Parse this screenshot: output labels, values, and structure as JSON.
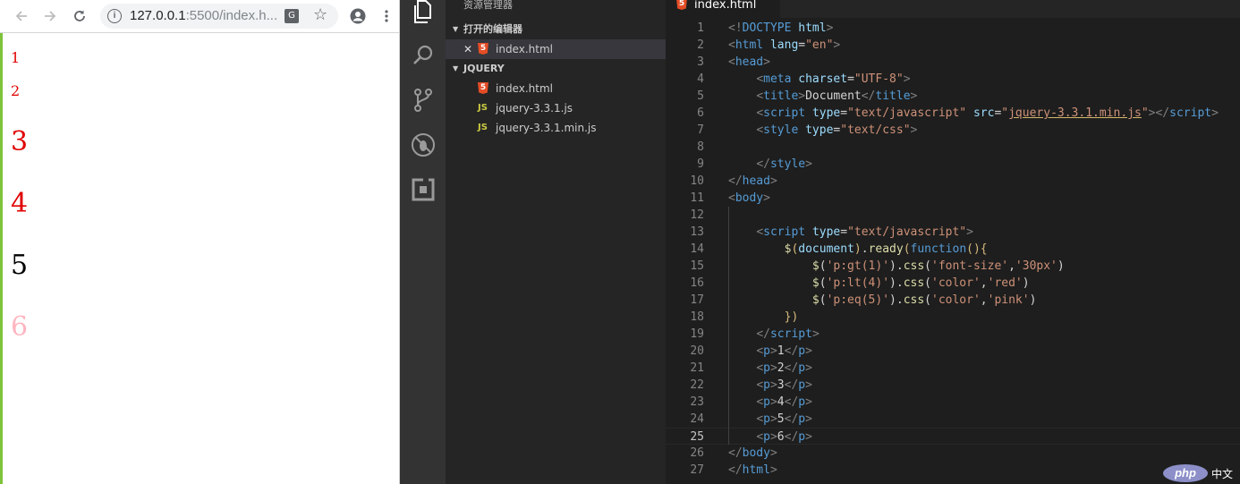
{
  "browser": {
    "url_host": "127.0.0.1",
    "url_rest": ":5500/index.h...",
    "paragraphs": [
      {
        "text": "1",
        "color": "#e00000"
      },
      {
        "text": "2",
        "color": "#e00000"
      },
      {
        "text": "3",
        "color": "#e00000"
      },
      {
        "text": "4",
        "color": "#e00000"
      },
      {
        "text": "5",
        "color": "#000000"
      },
      {
        "text": "6",
        "color": "#ffb6c1"
      }
    ]
  },
  "sidebar": {
    "title": "资源管理器",
    "open_editors_label": "打开的编辑器",
    "open_editor_file": "index.html",
    "project_label": "JQUERY",
    "files": [
      {
        "name": "index.html",
        "type": "html"
      },
      {
        "name": "jquery-3.3.1.js",
        "type": "js"
      },
      {
        "name": "jquery-3.3.1.min.js",
        "type": "js"
      }
    ],
    "html_badge": "5",
    "js_badge": "JS"
  },
  "editor": {
    "tab_label": "index.html",
    "current_line": 25,
    "lines": [
      [
        [
          "t-bracket",
          "<!"
        ],
        [
          "t-tag",
          "DOCTYPE"
        ],
        [
          "t-text",
          " "
        ],
        [
          "t-attr",
          "html"
        ],
        [
          "t-bracket",
          ">"
        ]
      ],
      [
        [
          "t-bracket",
          "<"
        ],
        [
          "t-tag",
          "html"
        ],
        [
          "t-text",
          " "
        ],
        [
          "t-attr",
          "lang"
        ],
        [
          "t-text",
          "="
        ],
        [
          "t-str",
          "\"en\""
        ],
        [
          "t-bracket",
          ">"
        ]
      ],
      [
        [
          "t-bracket",
          "<"
        ],
        [
          "t-tag",
          "head"
        ],
        [
          "t-bracket",
          ">"
        ]
      ],
      [
        [
          "t-text",
          "    "
        ],
        [
          "t-bracket",
          "<"
        ],
        [
          "t-tag",
          "meta"
        ],
        [
          "t-text",
          " "
        ],
        [
          "t-attr",
          "charset"
        ],
        [
          "t-text",
          "="
        ],
        [
          "t-str",
          "\"UTF-8\""
        ],
        [
          "t-bracket",
          ">"
        ]
      ],
      [
        [
          "t-text",
          "    "
        ],
        [
          "t-bracket",
          "<"
        ],
        [
          "t-tag",
          "title"
        ],
        [
          "t-bracket",
          ">"
        ],
        [
          "t-text",
          "Document"
        ],
        [
          "t-bracket",
          "</"
        ],
        [
          "t-tag",
          "title"
        ],
        [
          "t-bracket",
          ">"
        ]
      ],
      [
        [
          "t-text",
          "    "
        ],
        [
          "t-bracket",
          "<"
        ],
        [
          "t-tag",
          "script"
        ],
        [
          "t-text",
          " "
        ],
        [
          "t-attr",
          "type"
        ],
        [
          "t-text",
          "="
        ],
        [
          "t-str",
          "\"text/javascript\""
        ],
        [
          "t-text",
          " "
        ],
        [
          "t-attr",
          "src"
        ],
        [
          "t-text",
          "="
        ],
        [
          "t-str",
          "\""
        ],
        [
          "t-str t-under",
          "jquery-3.3.1.min.js"
        ],
        [
          "t-str",
          "\""
        ],
        [
          "t-bracket",
          "></"
        ],
        [
          "t-tag",
          "script"
        ],
        [
          "t-bracket",
          ">"
        ]
      ],
      [
        [
          "t-text",
          "    "
        ],
        [
          "t-bracket",
          "<"
        ],
        [
          "t-tag",
          "style"
        ],
        [
          "t-text",
          " "
        ],
        [
          "t-attr",
          "type"
        ],
        [
          "t-text",
          "="
        ],
        [
          "t-str",
          "\"text/css\""
        ],
        [
          "t-bracket",
          ">"
        ]
      ],
      [],
      [
        [
          "t-text",
          "    "
        ],
        [
          "t-bracket",
          "</"
        ],
        [
          "t-tag",
          "style"
        ],
        [
          "t-bracket",
          ">"
        ]
      ],
      [
        [
          "t-bracket",
          "</"
        ],
        [
          "t-tag",
          "head"
        ],
        [
          "t-bracket",
          ">"
        ]
      ],
      [
        [
          "t-bracket",
          "<"
        ],
        [
          "t-tag",
          "body"
        ],
        [
          "t-bracket",
          ">"
        ]
      ],
      [],
      [
        [
          "t-text",
          "    "
        ],
        [
          "t-bracket",
          "<"
        ],
        [
          "t-tag",
          "script"
        ],
        [
          "t-text",
          " "
        ],
        [
          "t-attr",
          "type"
        ],
        [
          "t-text",
          "="
        ],
        [
          "t-str",
          "\"text/javascript\""
        ],
        [
          "t-bracket",
          ">"
        ]
      ],
      [
        [
          "t-text",
          "        "
        ],
        [
          "t-fn",
          "$"
        ],
        [
          "t-gold",
          "("
        ],
        [
          "t-attr",
          "document"
        ],
        [
          "t-gold",
          ")"
        ],
        [
          "t-text",
          "."
        ],
        [
          "t-fn",
          "ready"
        ],
        [
          "t-gold",
          "("
        ],
        [
          "t-kw",
          "function"
        ],
        [
          "t-gold",
          "(){"
        ]
      ],
      [
        [
          "t-text",
          "            "
        ],
        [
          "t-fn",
          "$"
        ],
        [
          "t-text",
          "("
        ],
        [
          "t-str",
          "'p:gt(1)'"
        ],
        [
          "t-text",
          ")."
        ],
        [
          "t-fn",
          "css"
        ],
        [
          "t-text",
          "("
        ],
        [
          "t-str",
          "'font-size'"
        ],
        [
          "t-text",
          ","
        ],
        [
          "t-str",
          "'30px'"
        ],
        [
          "t-text",
          ")"
        ]
      ],
      [
        [
          "t-text",
          "            "
        ],
        [
          "t-fn",
          "$"
        ],
        [
          "t-text",
          "("
        ],
        [
          "t-str",
          "'p:lt(4)'"
        ],
        [
          "t-text",
          ")."
        ],
        [
          "t-fn",
          "css"
        ],
        [
          "t-text",
          "("
        ],
        [
          "t-str",
          "'color'"
        ],
        [
          "t-text",
          ","
        ],
        [
          "t-str",
          "'red'"
        ],
        [
          "t-text",
          ")"
        ]
      ],
      [
        [
          "t-text",
          "            "
        ],
        [
          "t-fn",
          "$"
        ],
        [
          "t-text",
          "("
        ],
        [
          "t-str",
          "'p:eq(5)'"
        ],
        [
          "t-text",
          ")."
        ],
        [
          "t-fn",
          "css"
        ],
        [
          "t-text",
          "("
        ],
        [
          "t-str",
          "'color'"
        ],
        [
          "t-text",
          ","
        ],
        [
          "t-str",
          "'pink'"
        ],
        [
          "t-text",
          ")"
        ]
      ],
      [
        [
          "t-text",
          "        "
        ],
        [
          "t-gold",
          "})"
        ]
      ],
      [
        [
          "t-text",
          "    "
        ],
        [
          "t-bracket",
          "</"
        ],
        [
          "t-tag",
          "script"
        ],
        [
          "t-bracket",
          ">"
        ]
      ],
      [
        [
          "t-text",
          "    "
        ],
        [
          "t-bracket",
          "<"
        ],
        [
          "t-tag",
          "p"
        ],
        [
          "t-bracket",
          ">"
        ],
        [
          "t-text",
          "1"
        ],
        [
          "t-bracket",
          "</"
        ],
        [
          "t-tag",
          "p"
        ],
        [
          "t-bracket",
          ">"
        ]
      ],
      [
        [
          "t-text",
          "    "
        ],
        [
          "t-bracket",
          "<"
        ],
        [
          "t-tag",
          "p"
        ],
        [
          "t-bracket",
          ">"
        ],
        [
          "t-text",
          "2"
        ],
        [
          "t-bracket",
          "</"
        ],
        [
          "t-tag",
          "p"
        ],
        [
          "t-bracket",
          ">"
        ]
      ],
      [
        [
          "t-text",
          "    "
        ],
        [
          "t-bracket",
          "<"
        ],
        [
          "t-tag",
          "p"
        ],
        [
          "t-bracket",
          ">"
        ],
        [
          "t-text",
          "3"
        ],
        [
          "t-bracket",
          "</"
        ],
        [
          "t-tag",
          "p"
        ],
        [
          "t-bracket",
          ">"
        ]
      ],
      [
        [
          "t-text",
          "    "
        ],
        [
          "t-bracket",
          "<"
        ],
        [
          "t-tag",
          "p"
        ],
        [
          "t-bracket",
          ">"
        ],
        [
          "t-text",
          "4"
        ],
        [
          "t-bracket",
          "</"
        ],
        [
          "t-tag",
          "p"
        ],
        [
          "t-bracket",
          ">"
        ]
      ],
      [
        [
          "t-text",
          "    "
        ],
        [
          "t-bracket",
          "<"
        ],
        [
          "t-tag",
          "p"
        ],
        [
          "t-bracket",
          ">"
        ],
        [
          "t-text",
          "5"
        ],
        [
          "t-bracket",
          "</"
        ],
        [
          "t-tag",
          "p"
        ],
        [
          "t-bracket",
          ">"
        ]
      ],
      [
        [
          "t-text",
          "    "
        ],
        [
          "t-bracket",
          "<"
        ],
        [
          "t-tag",
          "p"
        ],
        [
          "t-bracket",
          ">"
        ],
        [
          "t-text",
          "6"
        ],
        [
          "t-bracket",
          "</"
        ],
        [
          "t-tag",
          "p"
        ],
        [
          "t-bracket",
          ">"
        ]
      ],
      [
        [
          "t-bracket",
          "</"
        ],
        [
          "t-tag",
          "body"
        ],
        [
          "t-bracket",
          ">"
        ]
      ],
      [
        [
          "t-bracket",
          "</"
        ],
        [
          "t-tag",
          "html"
        ],
        [
          "t-bracket",
          ">"
        ]
      ]
    ]
  },
  "watermark": {
    "logo": "php",
    "text": "中文网"
  }
}
